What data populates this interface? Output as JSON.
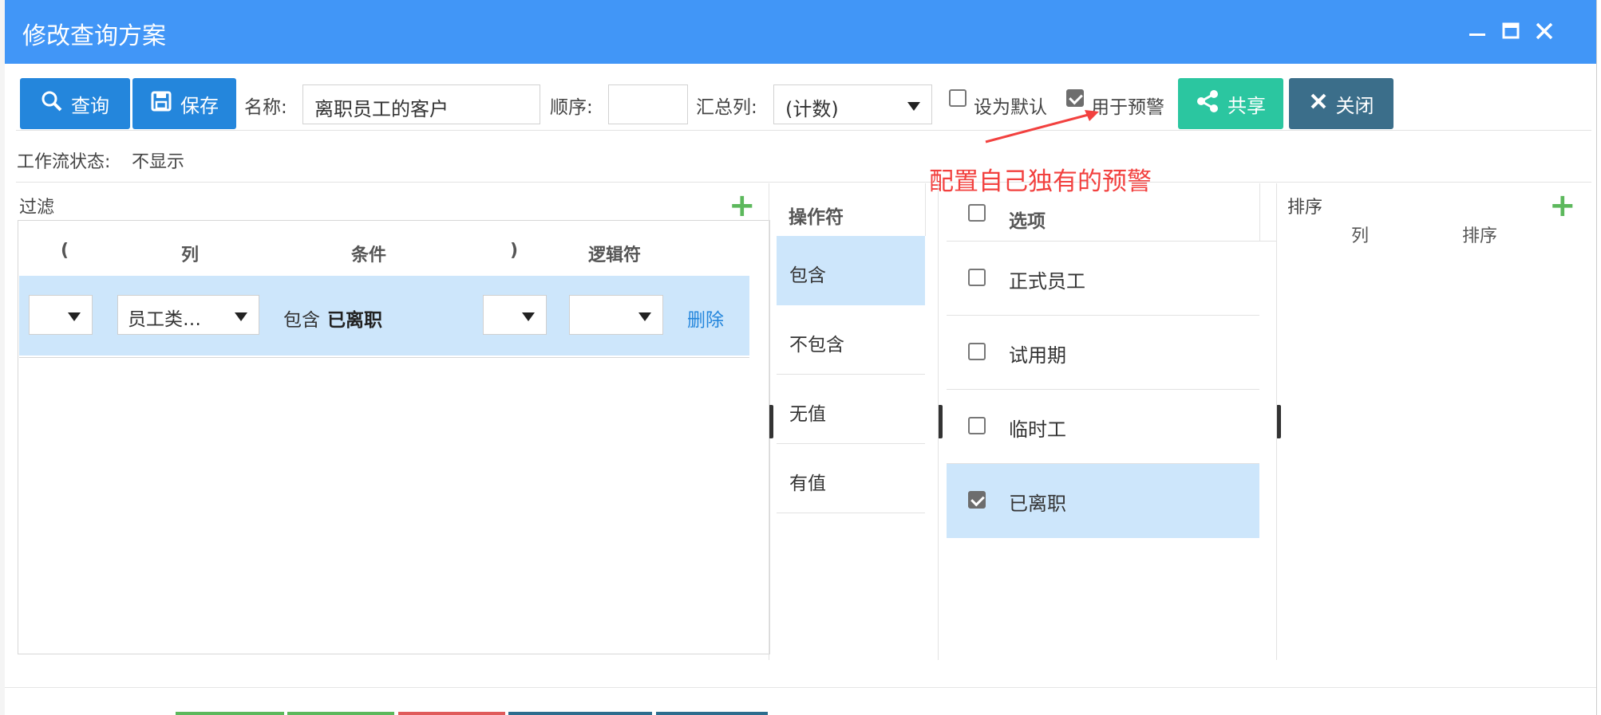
{
  "dialog": {
    "title": "修改查询方案"
  },
  "toolbar": {
    "query_label": "查询",
    "save_label": "保存",
    "name_label": "名称:",
    "name_value": "离职员工的客户",
    "order_label": "顺序:",
    "order_value": "",
    "summary_label": "汇总列:",
    "summary_value": "(计数)",
    "default_label": "设为默认",
    "alert_label": "用于预警",
    "share_label": "共享",
    "close_label": "关闭"
  },
  "workflow": {
    "label": "工作流状态:",
    "value": "不显示"
  },
  "annotation": {
    "text": "配置自己独有的预警"
  },
  "filter": {
    "title": "过滤",
    "headers": {
      "open_paren": "(",
      "column": "列",
      "condition": "条件",
      "close_paren": ")",
      "logic": "逻辑符"
    },
    "row": {
      "open_paren": "",
      "column": "员工类…",
      "condition_op": "包含",
      "condition_value": "已离职",
      "close_paren": "",
      "logic": "",
      "delete_label": "删除"
    }
  },
  "operators": {
    "header": "操作符",
    "items": [
      "包含",
      "不包含",
      "无值",
      "有值"
    ],
    "selected": "包含"
  },
  "options": {
    "header": "选项",
    "items": [
      {
        "label": "正式员工",
        "checked": false
      },
      {
        "label": "试用期",
        "checked": false
      },
      {
        "label": "临时工",
        "checked": false
      },
      {
        "label": "已离职",
        "checked": true
      }
    ]
  },
  "sort": {
    "title": "排序",
    "col_header": "列",
    "order_header": "排序"
  },
  "colors": {
    "titlebar": "#4196f7",
    "primary": "#2486dc",
    "share": "#2bc6a0",
    "close": "#3b6e8a",
    "selected_row": "#cde6fb",
    "annotation": "#f2413f",
    "add": "#5cb85c"
  }
}
